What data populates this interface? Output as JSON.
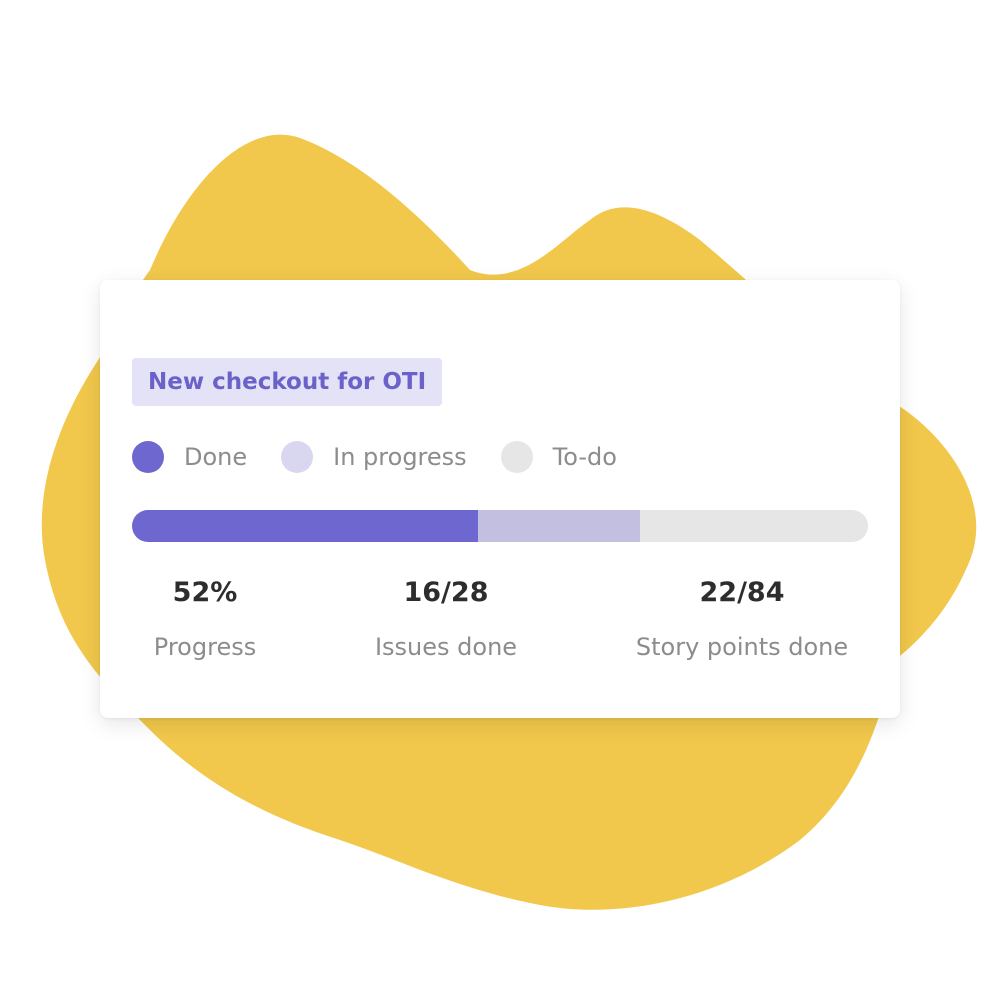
{
  "colors": {
    "blob": "#f1c84b",
    "done": "#6e67d0",
    "in_progress": "#c2bfe0",
    "todo": "#e6e6e6",
    "in_progress_dot": "#d9d6f0",
    "tag_bg": "#e4e2f6",
    "tag_text": "#6a62c9"
  },
  "card": {
    "tag": "New checkout for OTI",
    "legend": [
      {
        "label": "Done",
        "key": "done"
      },
      {
        "label": "In progress",
        "key": "in_progress"
      },
      {
        "label": "To-do",
        "key": "todo"
      }
    ],
    "progress_bar": {
      "done_fraction": 0.47,
      "in_progress_fraction": 0.22,
      "todo_fraction": 0.31
    },
    "stats": [
      {
        "value": "52%",
        "label": "Progress"
      },
      {
        "value": "16/28",
        "label": "Issues done"
      },
      {
        "value": "22/84",
        "label": "Story points done"
      }
    ]
  }
}
